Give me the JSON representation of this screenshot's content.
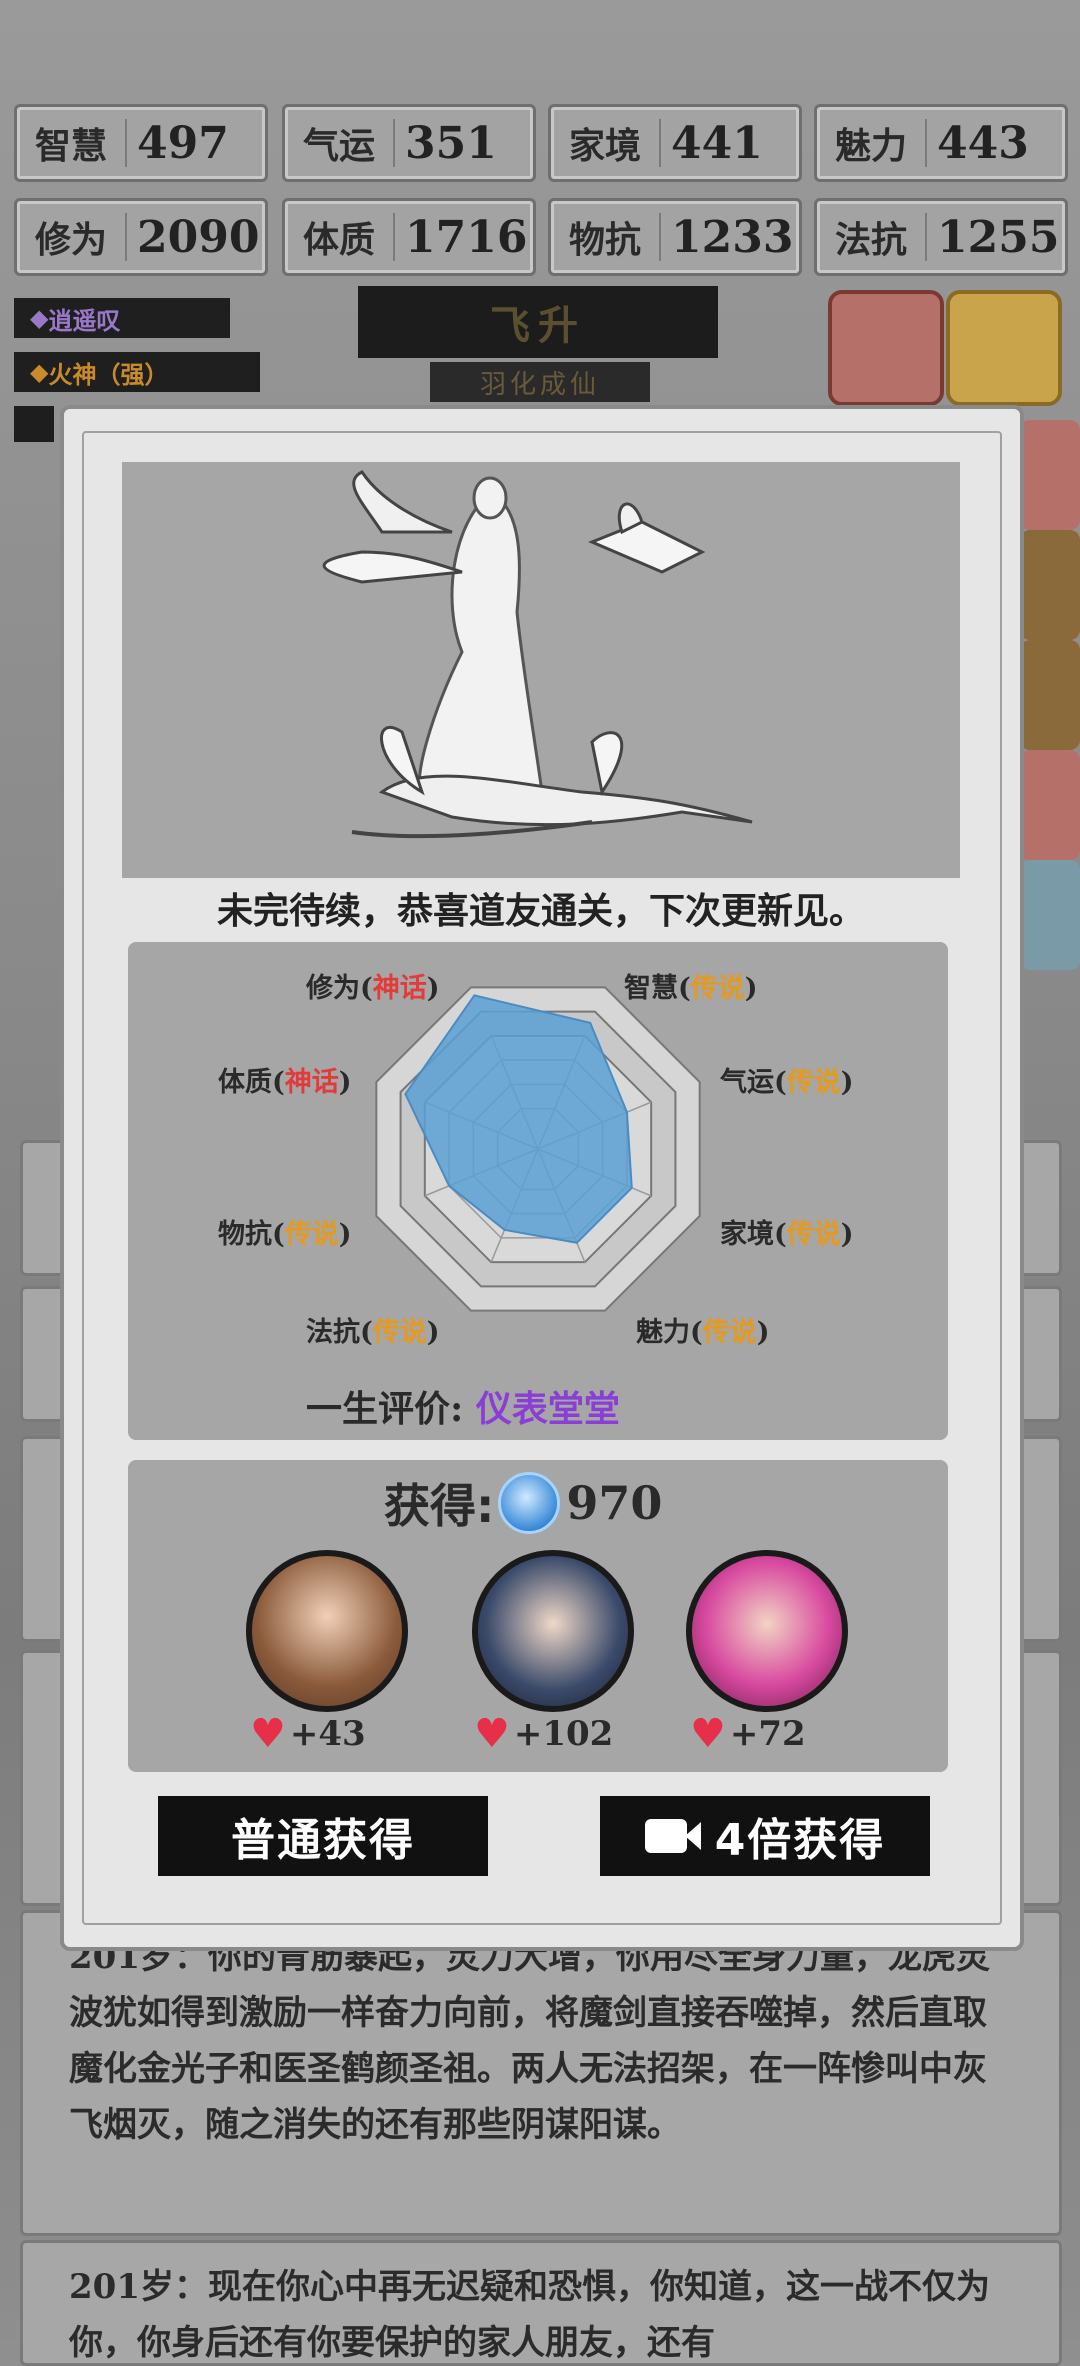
{
  "stats": [
    {
      "label": "智慧",
      "value": "497"
    },
    {
      "label": "气运",
      "value": "351"
    },
    {
      "label": "家境",
      "value": "441"
    },
    {
      "label": "魅力",
      "value": "443"
    },
    {
      "label": "修为",
      "value": "2090"
    },
    {
      "label": "体质",
      "value": "1716"
    },
    {
      "label": "物抗",
      "value": "1233"
    },
    {
      "label": "法抗",
      "value": "1255"
    }
  ],
  "tags": [
    "逍遥叹",
    "火神（强）"
  ],
  "banner": {
    "title": "飞升",
    "subtitle": "羽化成仙"
  },
  "modal": {
    "caption": "未完待续，恭喜道友通关，下次更新见。",
    "radar": {
      "labels": [
        {
          "name": "修为",
          "grade": "神话",
          "tone": "red"
        },
        {
          "name": "智慧",
          "grade": "传说",
          "tone": "gold"
        },
        {
          "name": "气运",
          "grade": "传说",
          "tone": "gold"
        },
        {
          "name": "家境",
          "grade": "传说",
          "tone": "gold"
        },
        {
          "name": "魅力",
          "grade": "传说",
          "tone": "gold"
        },
        {
          "name": "法抗",
          "grade": "传说",
          "tone": "gold"
        },
        {
          "name": "物抗",
          "grade": "传说",
          "tone": "gold"
        },
        {
          "name": "体质",
          "grade": "神话",
          "tone": "red"
        }
      ],
      "values": [
        0.95,
        0.78,
        0.55,
        0.58,
        0.58,
        0.5,
        0.55,
        0.82
      ]
    },
    "rating": {
      "label": "一生评价:",
      "value": "仪表堂堂"
    },
    "gain": {
      "label": "获得:",
      "amount": "970"
    },
    "companions": [
      {
        "name": "companion-1",
        "favor": "+43"
      },
      {
        "name": "companion-2",
        "favor": "+102"
      },
      {
        "name": "companion-3",
        "favor": "+72"
      }
    ],
    "buttons": {
      "normal": "普通获得",
      "video": "4倍获得"
    }
  },
  "log": [
    {
      "text": "201岁：你的青筋暴起，灵力大增，你用尽全身力量，龙虎灵波犹如得到激励一样奋力向前，将魔剑直接吞噬掉，然后直取魔化金光子和医圣鹤颜圣祖。两人无法招架，在一阵惨叫中灰飞烟灭，随之消失的还有那些阴谋阳谋。"
    },
    {
      "text": "201岁：现在你心中再无迟疑和恐惧，你知道，这一战不仅为你，你身后还有你要保护的家人朋友，还有"
    }
  ],
  "colors": {
    "accent": "#8a3ed6",
    "myth": "#e23b3b",
    "legend": "#e39a22",
    "radar_fill": "#5a9fd4"
  }
}
